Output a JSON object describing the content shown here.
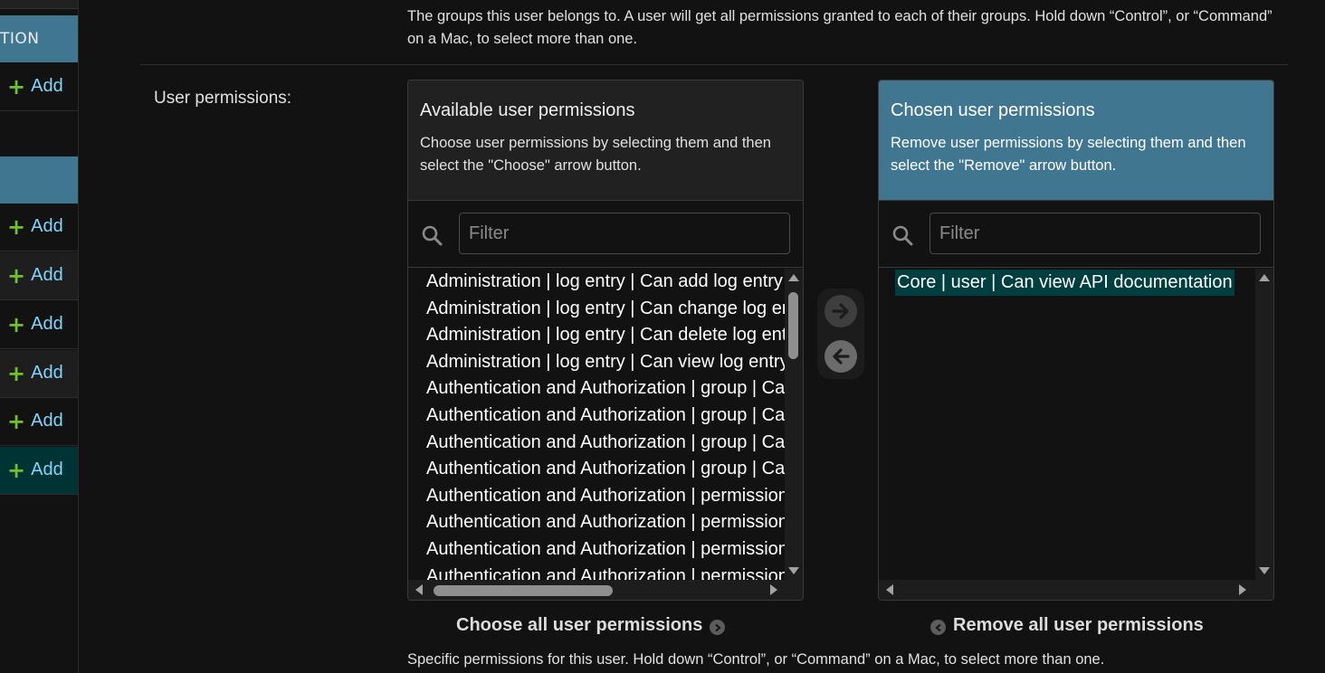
{
  "sidebar": {
    "section1_label": "TION",
    "add_label": "Add",
    "rows": [
      {
        "add": "Add"
      },
      {
        "add": "Add"
      },
      {
        "add": "Add"
      },
      {
        "add": "Add"
      },
      {
        "add": "Add"
      },
      {
        "add": "Add"
      },
      {
        "add": "Add"
      }
    ]
  },
  "groups_help": "The groups this user belongs to. A user will get all permissions granted to each of their groups. Hold down “Control”, or “Command” on a Mac, to select more than one.",
  "field_label": "User permissions:",
  "available": {
    "title": "Available user permissions",
    "description": "Choose user permissions by selecting them and then select the \"Choose\" arrow button.",
    "filter_placeholder": "Filter",
    "options": [
      "Administration | log entry | Can add log entry",
      "Administration | log entry | Can change log entry",
      "Administration | log entry | Can delete log entry",
      "Administration | log entry | Can view log entry",
      "Authentication and Authorization | group | Can add group",
      "Authentication and Authorization | group | Can change group",
      "Authentication and Authorization | group | Can delete group",
      "Authentication and Authorization | group | Can view group",
      "Authentication and Authorization | permission | Can add permission",
      "Authentication and Authorization | permission | Can change permission",
      "Authentication and Authorization | permission | Can delete permission",
      "Authentication and Authorization | permission | Can view permission"
    ]
  },
  "chosen": {
    "title": "Chosen user permissions",
    "description": "Remove user permissions by selecting them and then select the \"Remove\" arrow button.",
    "filter_placeholder": "Filter",
    "options": [
      "Core | user | Can view API documentation"
    ]
  },
  "choose_all_label": "Choose all user permissions",
  "remove_all_label": "Remove all user permissions",
  "permissions_help": "Specific permissions for this user. Hold down “Control”, or “Command” on a Mac, to select more than one."
}
